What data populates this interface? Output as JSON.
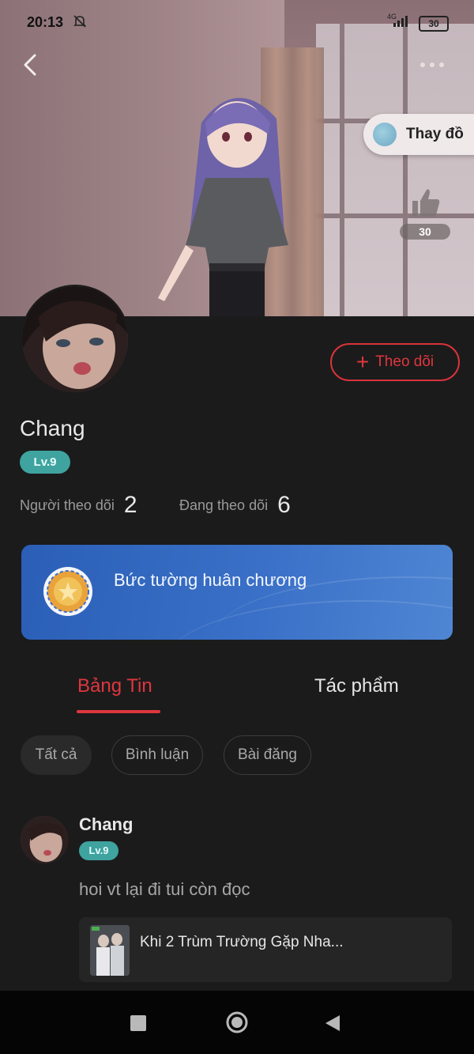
{
  "status_bar": {
    "time": "20:13",
    "network": "4G",
    "battery": "30",
    "mute_icon": "bell-off-icon"
  },
  "hero": {
    "back_icon": "chevron-left-icon",
    "more_icon": "more-dots-icon",
    "dress_up_label": "Thay đồ",
    "like_count": "30",
    "like_icon": "thumbs-up-icon"
  },
  "profile": {
    "name": "Chang",
    "level": "Lv.9",
    "follow_label": "Theo dõi",
    "followers_label": "Người theo dõi",
    "followers_count": "2",
    "following_label": "Đang theo dõi",
    "following_count": "6"
  },
  "medal_wall": {
    "label": "Bức tường huân chương",
    "icon": "medal-icon"
  },
  "tabs": [
    {
      "label": "Bảng Tin",
      "active": true
    },
    {
      "label": "Tác phẩm",
      "active": false
    }
  ],
  "filters": [
    {
      "label": "Tất cả",
      "selected": true
    },
    {
      "label": "Bình luận",
      "selected": false
    },
    {
      "label": "Bài đăng",
      "selected": false
    }
  ],
  "post": {
    "author": "Chang",
    "level": "Lv.9",
    "text": "hoi vt lại đi tui còn đọc",
    "link_title": "Khi 2 Trùm Trường Gặp Nha..."
  },
  "colors": {
    "accent": "#e0363d",
    "level": "#3fa39f",
    "medal_card": "#3a70c7",
    "background": "#1b1b1c"
  }
}
